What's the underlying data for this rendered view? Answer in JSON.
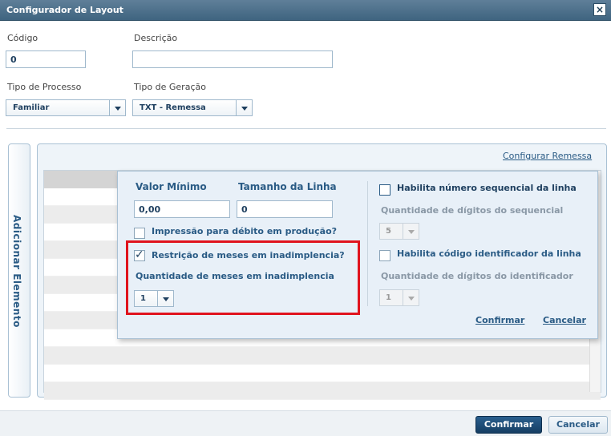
{
  "dialog": {
    "title": "Configurador de Layout",
    "close_icon": "×"
  },
  "fields": {
    "codigo_label": "Código",
    "codigo_value": "0",
    "descricao_label": "Descrição",
    "descricao_value": "",
    "tipo_processo_label": "Tipo de Processo",
    "tipo_processo_value": "Familiar",
    "tipo_geracao_label": "Tipo de Geração",
    "tipo_geracao_value": "TXT - Remessa"
  },
  "side_tab": {
    "label": "Adicionar Elemento"
  },
  "main_panel": {
    "config_link": "Configurar Remessa"
  },
  "popup": {
    "valor_minimo_label": "Valor Mínimo",
    "valor_minimo_value": "0,00",
    "tamanho_linha_label": "Tamanho da Linha",
    "tamanho_linha_value": "0",
    "impressao_label": "Impressão para débito em produção?",
    "impressao_checked": false,
    "restricao_label": "Restrição de meses em inadimplencia?",
    "restricao_checked": true,
    "qtd_meses_label": "Quantidade de meses em inadimplencia",
    "qtd_meses_value": "1",
    "habilita_seq_label": "Habilita número sequencial da linha",
    "habilita_seq_checked": false,
    "qtd_digitos_seq_label": "Quantidade de dígitos do sequencial",
    "qtd_digitos_seq_value": "5",
    "habilita_cod_label": "Habilita código identificador da linha",
    "habilita_cod_checked": false,
    "qtd_digitos_id_label": "Quantidade de dígitos do identificador",
    "qtd_digitos_id_value": "1",
    "confirmar_label": "Confirmar",
    "cancelar_label": "Cancelar"
  },
  "footer": {
    "confirmar_label": "Confirmar",
    "cancelar_label": "Cancelar"
  },
  "colors": {
    "accent": "#2a5b85",
    "titlebar": "#4a6f8c",
    "highlight": "#e0141e"
  }
}
